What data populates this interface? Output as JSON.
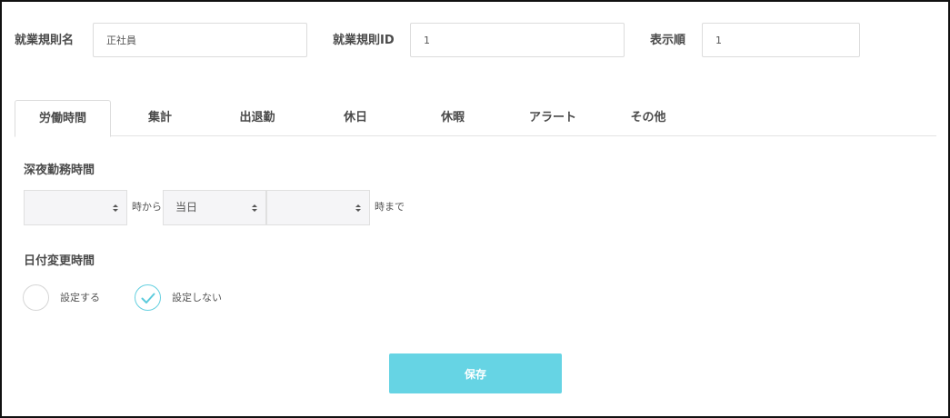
{
  "header": {
    "rule_name_label": "就業規則名",
    "rule_name_value": "正社員",
    "rule_id_label": "就業規則ID",
    "rule_id_value": "1",
    "order_label": "表示順",
    "order_value": "1"
  },
  "tabs": [
    {
      "label": "労働時間",
      "active": true
    },
    {
      "label": "集計",
      "active": false
    },
    {
      "label": "出退勤",
      "active": false
    },
    {
      "label": "休日",
      "active": false
    },
    {
      "label": "休暇",
      "active": false
    },
    {
      "label": "アラート",
      "active": false
    },
    {
      "label": "その他",
      "active": false
    }
  ],
  "night_work": {
    "title": "深夜勤務時間",
    "start_hour_value": "",
    "from_text": "時から",
    "day_value": "当日",
    "end_hour_value": "",
    "until_text": "時まで"
  },
  "date_change": {
    "title": "日付変更時間",
    "option_set": "設定する",
    "option_not_set": "設定しない",
    "selected": "設定しない"
  },
  "actions": {
    "save_label": "保存"
  },
  "colors": {
    "accent": "#66d4e4",
    "check": "#5ccbdc",
    "text": "#4a4a4a"
  }
}
